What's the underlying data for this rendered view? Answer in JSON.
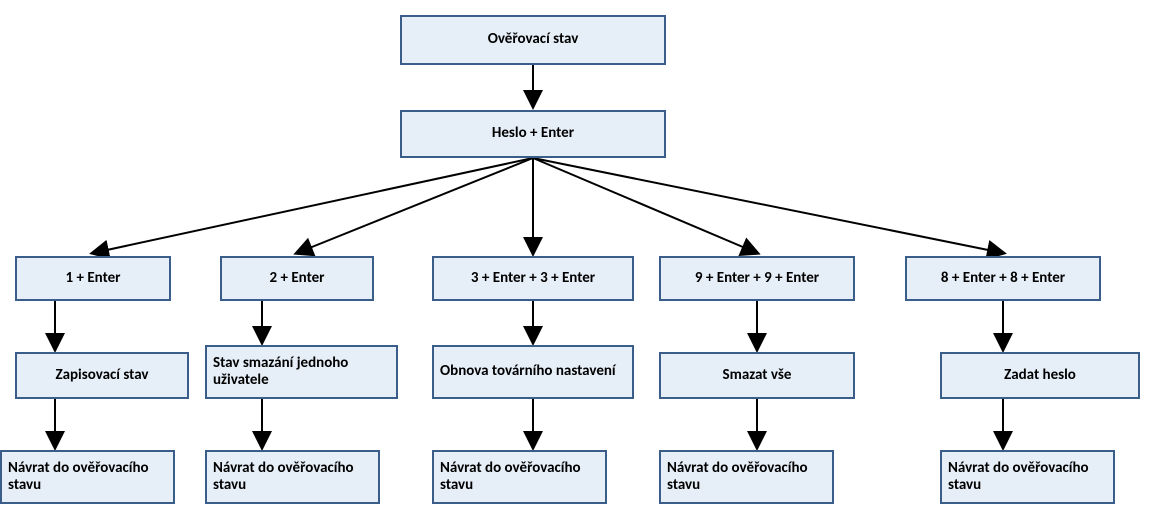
{
  "colors": {
    "node_fill": "#e6eef7",
    "node_border": "#3a5d8a",
    "arrow": "#000000"
  },
  "root": {
    "label": "Ověřovací stav"
  },
  "password": {
    "label": "Heslo + Enter"
  },
  "branches": [
    {
      "entry": {
        "label": "1 + Enter"
      },
      "action": {
        "label": "Zapisovací stav"
      },
      "return": {
        "label": "Návrat do ověřovacího stavu"
      }
    },
    {
      "entry": {
        "label": "2 + Enter"
      },
      "action": {
        "label": "Stav smazání jednoho uživatele"
      },
      "return": {
        "label": "Návrat do ověřovacího stavu"
      }
    },
    {
      "entry": {
        "label": "3 + Enter + 3 + Enter"
      },
      "action": {
        "label": "Obnova továrního nastavení"
      },
      "return": {
        "label": "Návrat do ověřovacího stavu"
      }
    },
    {
      "entry": {
        "label": "9 + Enter + 9 + Enter"
      },
      "action": {
        "label": "Smazat vše"
      },
      "return": {
        "label": "Návrat do ověřovacího stavu"
      }
    },
    {
      "entry": {
        "label": "8 + Enter + 8 + Enter"
      },
      "action": {
        "label": "Zadat heslo"
      },
      "return": {
        "label": "Návrat do ověřovacího stavu"
      }
    }
  ]
}
